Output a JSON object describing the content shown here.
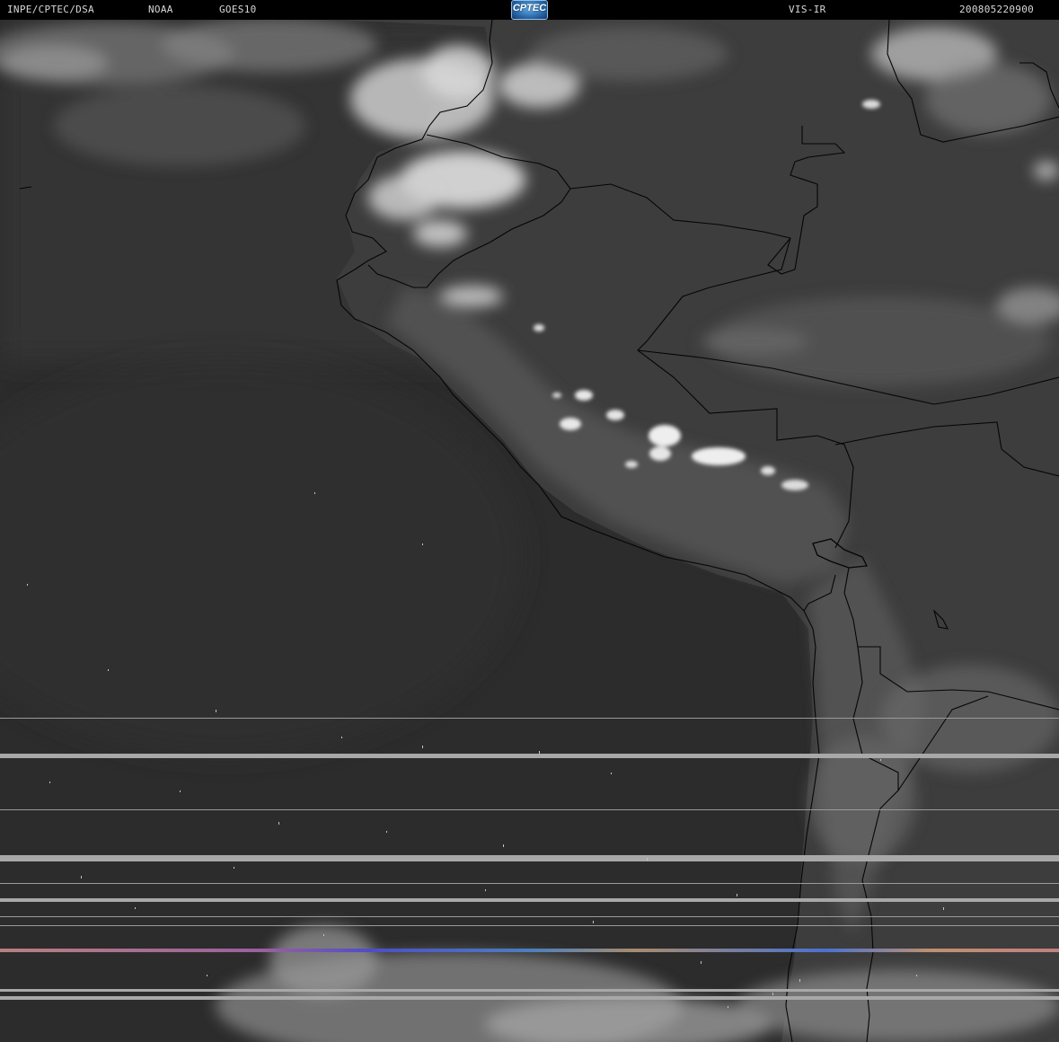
{
  "header": {
    "org": "INPE/CPTEC/DSA",
    "agency": "NOAA",
    "satellite": "GOES10",
    "logo_text": "CPTEC",
    "channel": "VIS-IR",
    "timestamp": "200805220900"
  },
  "colors": {
    "background": "#000000",
    "header_text": "#d8d8d8",
    "ocean": "#2b2b2b",
    "land": "#3a3a3a",
    "clouds": "#e8e8e8",
    "border_lines": "#050505",
    "scan_noise": "#b0b0b0"
  }
}
